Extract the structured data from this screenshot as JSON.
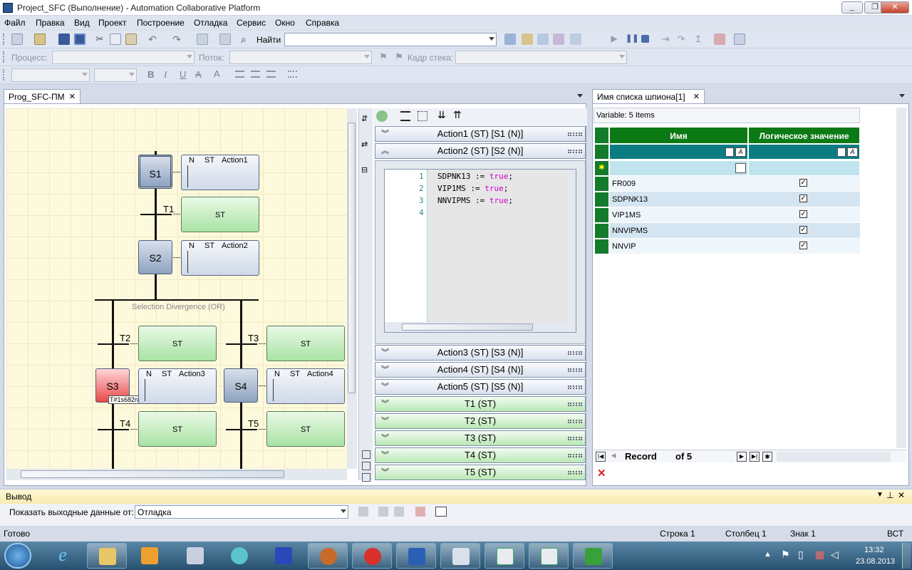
{
  "window": {
    "title": "Project_SFC (Выполнение) - Automation Collaborative Platform",
    "min": "_",
    "max": "❐",
    "close": "✕"
  },
  "menu": [
    "Файл",
    "Правка",
    "Вид",
    "Проект",
    "Построение",
    "Отладка",
    "Сервис",
    "Окно",
    "Справка"
  ],
  "toolbar": {
    "find_label": "Найти",
    "find_value": ""
  },
  "debugbar": {
    "process_label": "Процесс:",
    "thread_label": "Поток:",
    "stack_label": "Кадр стека:"
  },
  "format": {
    "bold": "B",
    "italic": "I",
    "underline": "U",
    "strike": "A"
  },
  "doc_tab": {
    "label": "Prog_SFC-ПМ",
    "close": "✕"
  },
  "sfc": {
    "steps": [
      {
        "id": "S1",
        "action": "Action1",
        "qualifier": "N",
        "type": "ST"
      },
      {
        "id": "S2",
        "action": "Action2",
        "qualifier": "N",
        "type": "ST"
      },
      {
        "id": "S3",
        "action": "Action3",
        "qualifier": "N",
        "type": "ST",
        "timer": "T#1s682n"
      },
      {
        "id": "S4",
        "action": "Action4",
        "qualifier": "N",
        "type": "ST"
      }
    ],
    "transitions": [
      "T1",
      "T2",
      "T3",
      "T4",
      "T5"
    ],
    "transition_type": "ST",
    "divergence_label": "Selection Divergence (OR)"
  },
  "actions_panel": {
    "rows_top": [
      "Action1 (ST) [S1 (N)]",
      "Action2 (ST) [S2 (N)]"
    ],
    "rows_bottom_blue": [
      "Action3 (ST) [S3 (N)]",
      "Action4 (ST) [S4 (N)]",
      "Action5 (ST) [S5 (N)]"
    ],
    "rows_bottom_green": [
      "T1 (ST)",
      "T2 (ST)",
      "T3 (ST)",
      "T4 (ST)",
      "T5 (ST)"
    ],
    "code_lines": [
      {
        "n": "1",
        "var": "SDPNK13",
        "op": " := ",
        "val": "true",
        "end": ";"
      },
      {
        "n": "2",
        "var": "VIP1MS",
        "op": " := ",
        "val": "true",
        "end": ";"
      },
      {
        "n": "3",
        "var": "NNVIPMS",
        "op": " := ",
        "val": "true",
        "end": ";"
      },
      {
        "n": "4",
        "var": "",
        "op": "",
        "val": "",
        "end": ""
      }
    ]
  },
  "spy": {
    "tab_label": "Имя списка шпиона[1]",
    "tab_close": "✕",
    "summary": "Variable: 5 Items",
    "columns": [
      "Имя",
      "Логическое значение"
    ],
    "rows": [
      {
        "name": "FR009",
        "value": true
      },
      {
        "name": "SDPNK13",
        "value": true
      },
      {
        "name": "VIP1MS",
        "value": true
      },
      {
        "name": "NNVIPMS",
        "value": true
      },
      {
        "name": "NNVIP",
        "value": true
      }
    ],
    "nav": {
      "record_label": "Record",
      "of_label": "of 5"
    }
  },
  "output": {
    "title": "Вывод",
    "show_label": "Показать выходные данные от:",
    "source": "Отладка"
  },
  "status": {
    "ready": "Готово",
    "line": "Строка 1",
    "col": "Столбец 1",
    "char": "Знак 1",
    "mode": "ВСТ"
  },
  "clock": {
    "time": "13:32",
    "date": "23.08.2013"
  }
}
